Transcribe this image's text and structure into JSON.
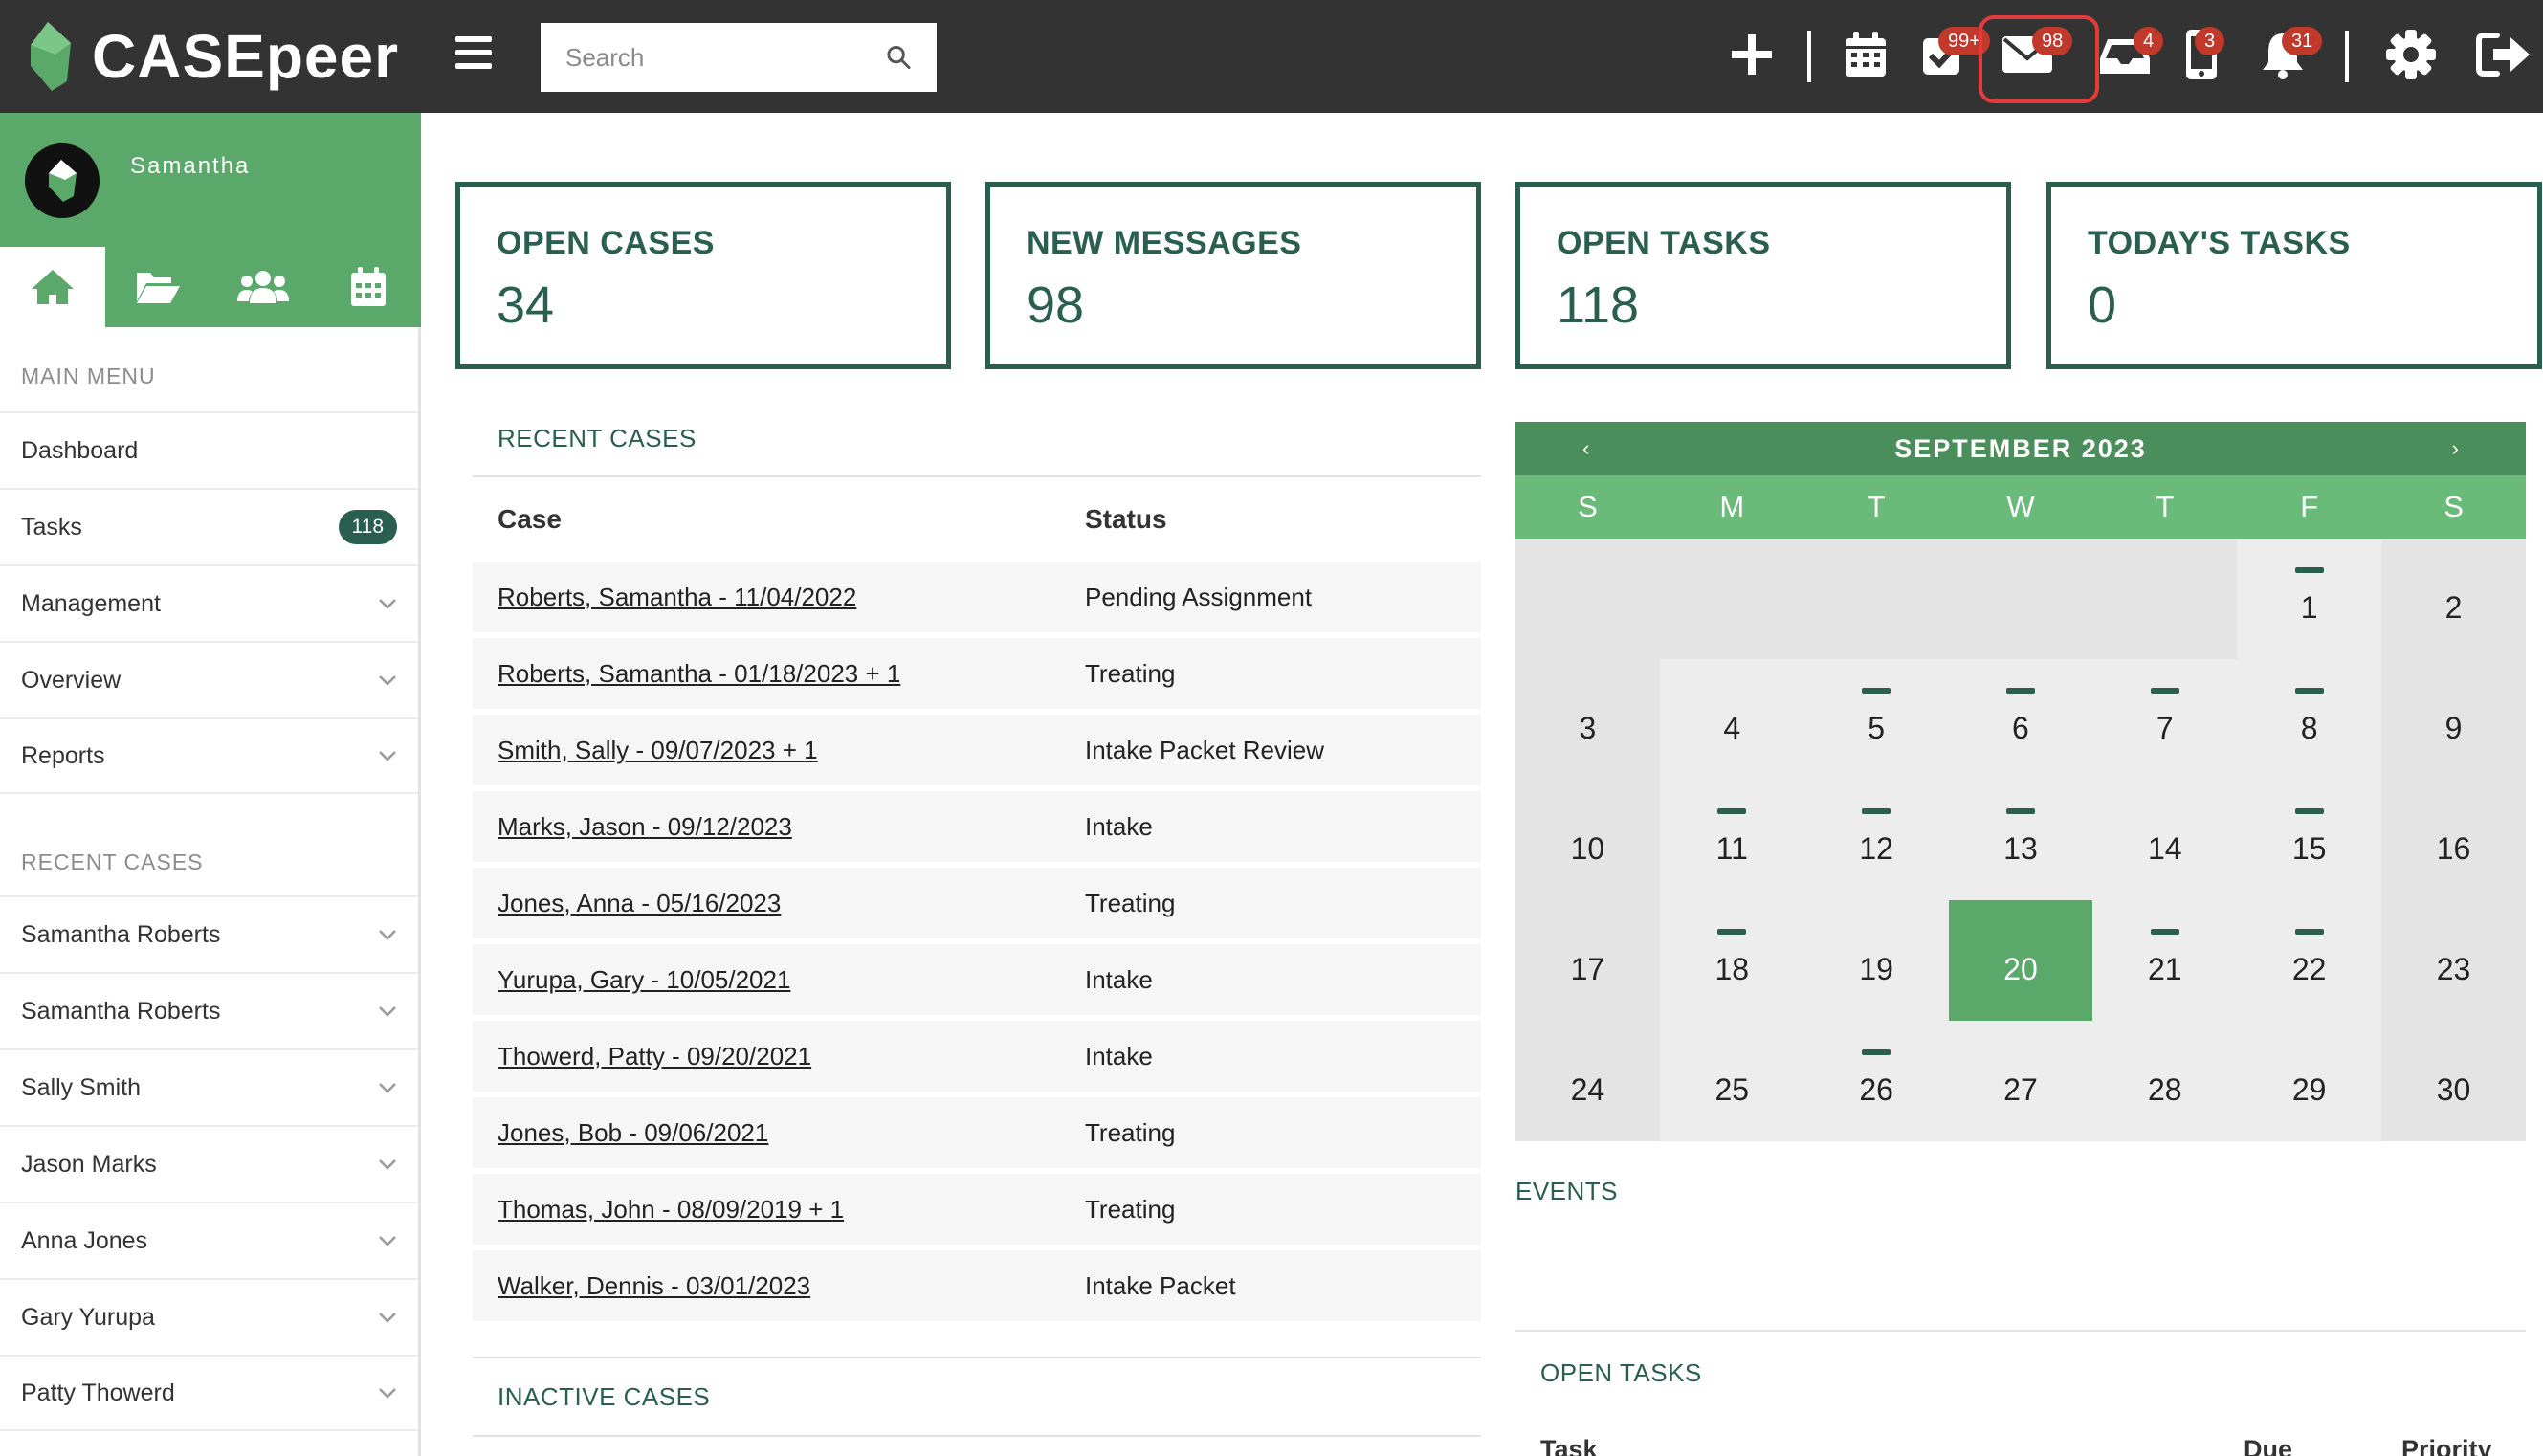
{
  "topbar": {
    "logo_text": "CASEpeer",
    "search_placeholder": "Search",
    "badges": {
      "tasks": "99+",
      "messages": "98",
      "inbox": "4",
      "phone": "3",
      "notifications": "31"
    }
  },
  "sidebar": {
    "user_name": "Samantha",
    "main_menu_heading": "MAIN MENU",
    "main_menu": [
      {
        "label": "Dashboard"
      },
      {
        "label": "Tasks",
        "count": "118"
      },
      {
        "label": "Management"
      },
      {
        "label": "Overview"
      },
      {
        "label": "Reports"
      }
    ],
    "recent_heading": "RECENT CASES",
    "recent_cases": [
      {
        "label": "Samantha Roberts"
      },
      {
        "label": "Samantha Roberts"
      },
      {
        "label": "Sally Smith"
      },
      {
        "label": "Jason Marks"
      },
      {
        "label": "Anna Jones"
      },
      {
        "label": "Gary Yurupa"
      },
      {
        "label": "Patty Thowerd"
      }
    ]
  },
  "stats": [
    {
      "label": "OPEN CASES",
      "value": "34"
    },
    {
      "label": "NEW MESSAGES",
      "value": "98"
    },
    {
      "label": "OPEN TASKS",
      "value": "118"
    },
    {
      "label": "TODAY'S TASKS",
      "value": "0"
    }
  ],
  "recent_cases": {
    "title": "RECENT CASES",
    "col_case": "Case",
    "col_status": "Status",
    "rows": [
      {
        "case": "Roberts, Samantha - 11/04/2022",
        "status": "Pending Assignment"
      },
      {
        "case": "Roberts, Samantha - 01/18/2023 + 1",
        "status": "Treating"
      },
      {
        "case": "Smith, Sally - 09/07/2023 + 1",
        "status": "Intake Packet Review"
      },
      {
        "case": "Marks, Jason - 09/12/2023",
        "status": "Intake"
      },
      {
        "case": "Jones, Anna - 05/16/2023",
        "status": "Treating"
      },
      {
        "case": "Yurupa, Gary - 10/05/2021",
        "status": "Intake"
      },
      {
        "case": "Thowerd, Patty - 09/20/2021",
        "status": "Intake"
      },
      {
        "case": "Jones, Bob - 09/06/2021",
        "status": "Treating"
      },
      {
        "case": "Thomas, John - 08/09/2019 + 1",
        "status": "Treating"
      },
      {
        "case": "Walker, Dennis - 03/01/2023",
        "status": "Intake Packet"
      }
    ]
  },
  "inactive_cases_title": "INACTIVE CASES",
  "calendar": {
    "title": "SEPTEMBER 2023",
    "prev": "‹",
    "next": "›",
    "weekdays": [
      "S",
      "M",
      "T",
      "W",
      "T",
      "F",
      "S"
    ],
    "leading_blanks": 5,
    "days": 30,
    "today": 20,
    "event_days": [
      1,
      5,
      6,
      7,
      8,
      11,
      12,
      13,
      15,
      18,
      21,
      22,
      26
    ]
  },
  "events_title": "EVENTS",
  "open_tasks": {
    "title": "OPEN TASKS",
    "col_task": "Task",
    "col_due": "Due",
    "col_priority": "Priority"
  }
}
